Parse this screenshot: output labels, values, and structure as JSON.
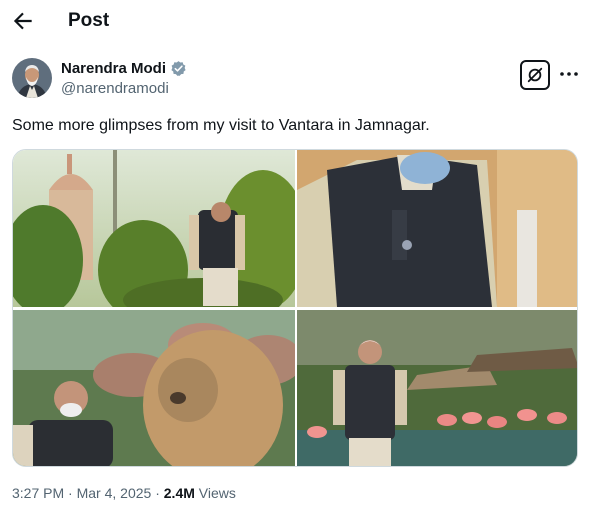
{
  "header": {
    "title": "Post"
  },
  "author": {
    "name": "Narendra Modi",
    "handle": "@narendramodi"
  },
  "tweet": {
    "text": "Some more glimpses from my visit to Vantara in Jamnagar."
  },
  "media": [
    {
      "icon": "photo-temple-garden"
    },
    {
      "icon": "photo-vest-closeup"
    },
    {
      "icon": "photo-lion"
    },
    {
      "icon": "photo-flamingos"
    }
  ],
  "meta": {
    "time": "3:27 PM",
    "separator": "·",
    "date": "Mar 4, 2025",
    "views_count": "2.4M",
    "views_label": "Views"
  },
  "colors": {
    "text": "#0f1419",
    "secondary": "#536471",
    "verified": "#829aab",
    "border": "#cfd9de"
  }
}
